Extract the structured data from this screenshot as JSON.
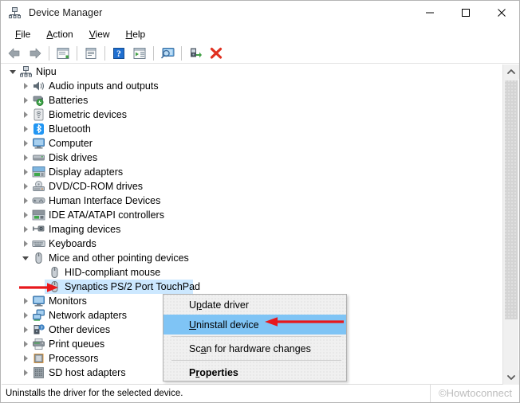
{
  "window": {
    "title": "Device Manager",
    "icon": "device-manager-icon",
    "controls": [
      {
        "name": "minimize",
        "glyph": "minimize-icon"
      },
      {
        "name": "maximize",
        "glyph": "maximize-icon"
      },
      {
        "name": "close",
        "glyph": "close-icon"
      }
    ]
  },
  "menubar": {
    "items": [
      {
        "accel": "F",
        "rest": "ile"
      },
      {
        "accel": "A",
        "rest": "ction"
      },
      {
        "accel": "V",
        "rest": "iew"
      },
      {
        "accel": "H",
        "rest": "elp"
      }
    ]
  },
  "toolbar": {
    "buttons": [
      {
        "name": "back-button",
        "icon": "back-arrow-icon"
      },
      {
        "name": "forward-button",
        "icon": "forward-arrow-icon"
      },
      {
        "name": "separator-1",
        "icon": "separator"
      },
      {
        "name": "show-hide-console-tree-button",
        "icon": "console-tree-icon"
      },
      {
        "name": "separator-2",
        "icon": "separator"
      },
      {
        "name": "properties-button",
        "icon": "properties-icon"
      },
      {
        "name": "separator-3",
        "icon": "separator"
      },
      {
        "name": "help-button",
        "icon": "help-question-icon"
      },
      {
        "name": "show-hide-action-pane-button",
        "icon": "action-pane-icon"
      },
      {
        "name": "separator-4",
        "icon": "separator"
      },
      {
        "name": "scan-for-hardware-changes-button",
        "icon": "scan-monitor-icon"
      },
      {
        "name": "separator-5",
        "icon": "separator"
      },
      {
        "name": "update-driver-button",
        "icon": "update-driver-icon"
      },
      {
        "name": "uninstall-device-button",
        "icon": "red-x-icon"
      }
    ]
  },
  "tree": {
    "root": {
      "label": "Nipu",
      "icon": "computer-root-icon",
      "expanded": true
    },
    "items": [
      {
        "label": "Audio inputs and outputs",
        "icon": "speaker-icon",
        "expandable": true,
        "selected": false
      },
      {
        "label": "Batteries",
        "icon": "battery-icon",
        "expandable": true,
        "selected": false
      },
      {
        "label": "Biometric devices",
        "icon": "fingerprint-icon",
        "expandable": true,
        "selected": false
      },
      {
        "label": "Bluetooth",
        "icon": "bluetooth-icon",
        "expandable": true,
        "selected": false
      },
      {
        "label": "Computer",
        "icon": "monitor-icon",
        "expandable": true,
        "selected": false
      },
      {
        "label": "Disk drives",
        "icon": "disk-drive-icon",
        "expandable": true,
        "selected": false
      },
      {
        "label": "Display adapters",
        "icon": "display-adapter-icon",
        "expandable": true,
        "selected": false
      },
      {
        "label": "DVD/CD-ROM drives",
        "icon": "optical-drive-icon",
        "expandable": true,
        "selected": false
      },
      {
        "label": "Human Interface Devices",
        "icon": "hid-icon",
        "expandable": true,
        "selected": false
      },
      {
        "label": "IDE ATA/ATAPI controllers",
        "icon": "ide-controller-icon",
        "expandable": true,
        "selected": false
      },
      {
        "label": "Imaging devices",
        "icon": "imaging-device-icon",
        "expandable": true,
        "selected": false
      },
      {
        "label": "Keyboards",
        "icon": "keyboard-icon",
        "expandable": true,
        "selected": false
      },
      {
        "label": "Mice and other pointing devices",
        "icon": "mouse-icon",
        "expandable": true,
        "expanded": true,
        "selected": false
      },
      {
        "label": "HID-compliant mouse",
        "icon": "mouse-icon",
        "expandable": false,
        "child": true,
        "selected": false
      },
      {
        "label": "Synaptics PS/2 Port TouchPad",
        "icon": "mouse-icon",
        "expandable": false,
        "child": true,
        "selected": true
      },
      {
        "label": "Monitors",
        "icon": "monitor-icon",
        "expandable": true,
        "selected": false
      },
      {
        "label": "Network adapters",
        "icon": "network-adapter-icon",
        "expandable": true,
        "selected": false
      },
      {
        "label": "Other devices",
        "icon": "other-device-icon",
        "expandable": true,
        "selected": false
      },
      {
        "label": "Print queues",
        "icon": "printer-icon",
        "expandable": true,
        "selected": false
      },
      {
        "label": "Processors",
        "icon": "processor-icon",
        "expandable": true,
        "selected": false
      },
      {
        "label": "SD host adapters",
        "icon": "sd-host-adapter-icon",
        "expandable": true,
        "selected": false
      }
    ]
  },
  "context_menu": {
    "items": [
      {
        "accel": "U",
        "before": "U",
        "mid": "p",
        "label": "Update driver",
        "pre": "U",
        "acc": "p",
        "post": "date driver",
        "highlighted": false,
        "bold": false
      },
      {
        "label": "Uninstall device",
        "pre": "",
        "acc": "U",
        "post": "ninstall device",
        "highlighted": true,
        "bold": false
      },
      {
        "separator": true
      },
      {
        "label": "Scan for hardware changes",
        "pre": "Sc",
        "acc": "a",
        "post": "n for hardware changes",
        "highlighted": false,
        "bold": false
      },
      {
        "separator": true
      },
      {
        "label": "Properties",
        "pre": "P",
        "acc": "r",
        "post": "operties",
        "highlighted": false,
        "bold": true
      }
    ]
  },
  "annotations": {
    "tree_arrow": {
      "name": "red-arrow-pointing-to-selected-device",
      "color": "#e8181c"
    },
    "menu_arrow": {
      "name": "red-arrow-pointing-to-uninstall-device",
      "color": "#e8181c"
    }
  },
  "scrollbar": {
    "up_arrow": "scroll-up-icon",
    "down_arrow": "scroll-down-icon",
    "thumb": "scroll-thumb"
  },
  "statusbar": {
    "text": "Uninstalls the driver for the selected device.",
    "watermark": "©Howtoconnect"
  },
  "colors": {
    "selection_blue": "#cce8ff",
    "menu_highlight_blue": "#7fc4f5",
    "annotation_red": "#e8181c",
    "window_bg": "#ffffff",
    "menu_bg": "#f0f0f0"
  }
}
